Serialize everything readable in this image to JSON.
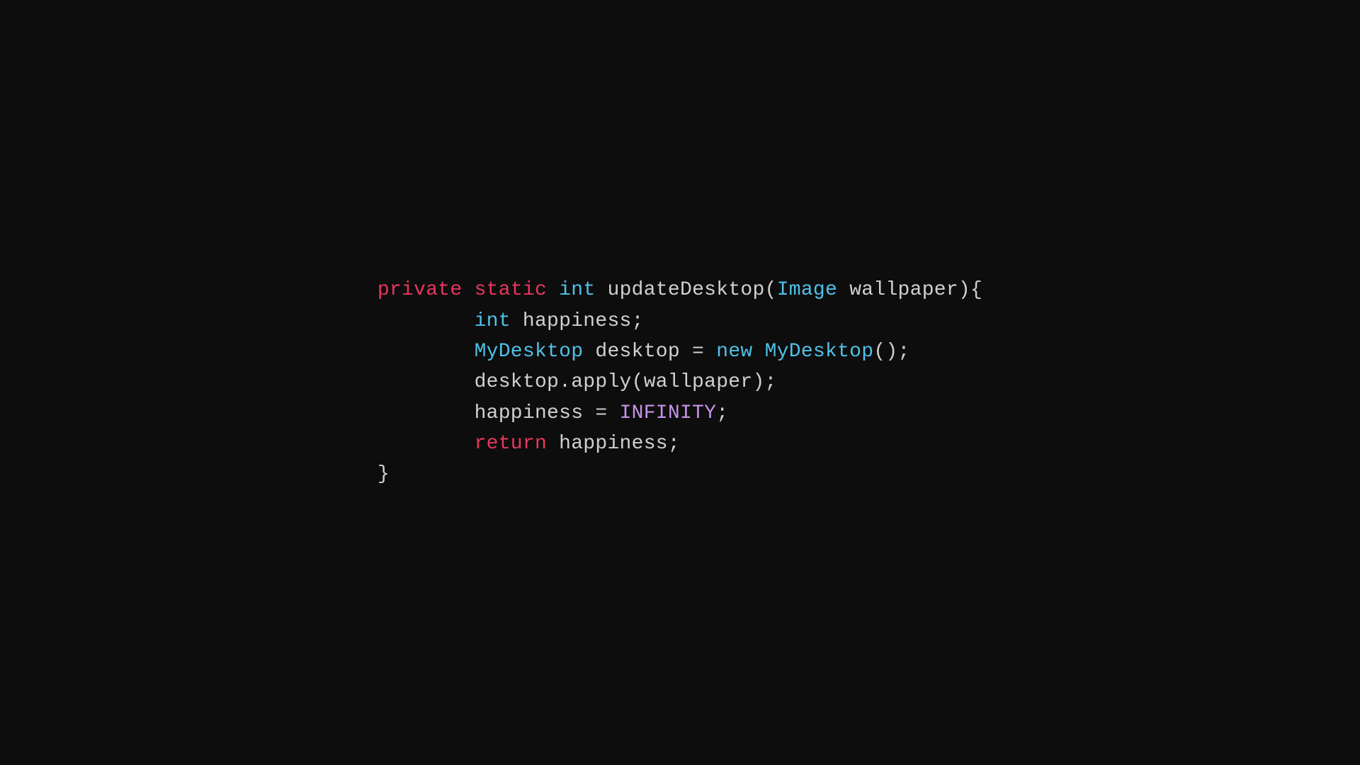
{
  "code": {
    "line1": {
      "kw1": "private",
      "sp1": " ",
      "kw2": "static",
      "sp2": " ",
      "kw3": "int",
      "sp3": " ",
      "rest": "updateDesktop(",
      "type": "Image",
      "rest2": " wallpaper){"
    },
    "line2": {
      "indent": "        ",
      "kw": "int",
      "rest": " happiness;"
    },
    "line3": {
      "indent": "        ",
      "type": "MyDesktop",
      "rest": " desktop = ",
      "kw": "new",
      "rest2": " ",
      "type2": "MyDesktop",
      "rest3": "();"
    },
    "line4": {
      "indent": "        ",
      "rest": "desktop.apply(wallpaper);"
    },
    "line5": {
      "indent": "        ",
      "rest": "happiness = ",
      "const": "INFINITY",
      "rest2": ";"
    },
    "line6": {
      "indent": "        ",
      "kw": "return",
      "rest": " happiness;"
    },
    "line7": {
      "rest": "}"
    }
  }
}
